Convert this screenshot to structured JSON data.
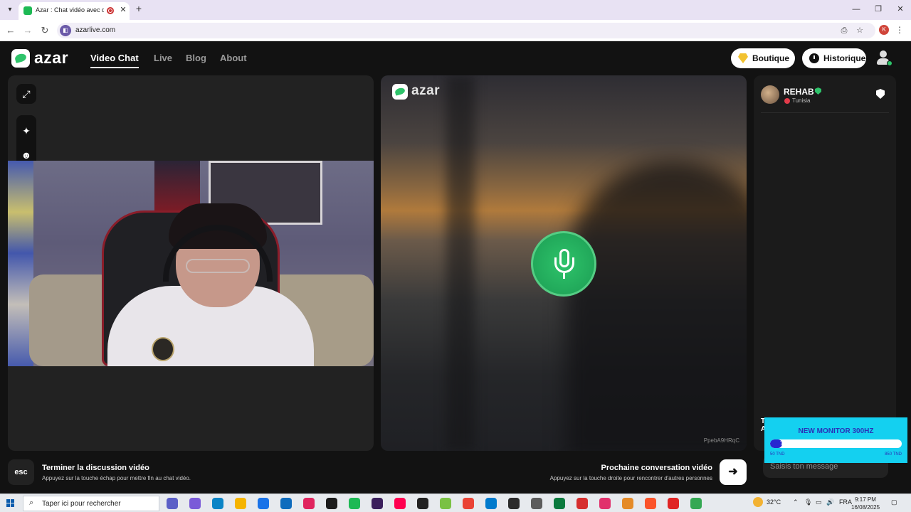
{
  "browser": {
    "tab_title": "Azar : Chat vidéo avec de nouvelles personnes",
    "url": "azarlive.com",
    "profile_initial": "K"
  },
  "site": {
    "logo_text": "azar",
    "nav": [
      {
        "label": "Video Chat",
        "active": true
      },
      {
        "label": "Live",
        "active": false
      },
      {
        "label": "Blog",
        "active": false
      },
      {
        "label": "About",
        "active": false
      }
    ],
    "shop_label": "Boutique",
    "history_label": "Historique"
  },
  "remote": {
    "logo_text": "azar",
    "id_text": "PpebA9HRqC",
    "icon": "microphone-icon"
  },
  "chat": {
    "partner_name": "REHAB",
    "partner_country": "Tunisia",
    "input_placeholder": "Saisis ton message"
  },
  "controls": {
    "esc_key": "esc",
    "end_title": "Terminer la discussion vidéo",
    "end_hint": "Appuyez sur la touche échap pour mettre fin au chat vidéo.",
    "next_title": "Prochaine conversation vidéo",
    "next_hint": "Appuyez sur la touche droite pour rencontrer d'autres personnes"
  },
  "ad": {
    "title": "NEW MONITOR 300HZ",
    "progress_value": 7,
    "progress_fraction": 0.09,
    "min_label": "50 TND",
    "max_label": "850 TND",
    "peek_text": "T A"
  },
  "taskbar": {
    "search_placeholder": "Taper ici pour rechercher",
    "temperature": "32°C",
    "language": "FRA",
    "time": "9:17 PM",
    "date": "16/08/2025",
    "app_colors": [
      "#5b5fc7",
      "#7a5ad8",
      "#0a84c6",
      "#f5b400",
      "#1a73e8",
      "#0f6cbd",
      "#e0245e",
      "#1c1c1c",
      "#1db954",
      "#3b1f5c",
      "#ff0050",
      "#222",
      "#7ac143",
      "#ea4335",
      "#007acc",
      "#2b2b2b",
      "#5c5c5c",
      "#0b7a3e",
      "#d62e2e",
      "#e1306c",
      "#e58b28",
      "#fb542b",
      "#e02424",
      "#34a853"
    ]
  }
}
